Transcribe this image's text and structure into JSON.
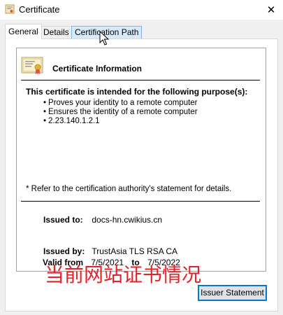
{
  "window": {
    "title": "Certificate",
    "close_glyph": "✕"
  },
  "tabs": [
    {
      "label": "General"
    },
    {
      "label": "Details"
    },
    {
      "label": "Certification Path"
    }
  ],
  "cert": {
    "info_title": "Certificate Information",
    "purpose_heading": "This certificate is intended for the following purpose(s):",
    "purposes": [
      "Proves your identity to a remote computer",
      "Ensures the identity of a remote computer",
      "2.23.140.1.2.1"
    ],
    "refer_note": "* Refer to the certification authority's statement for details.",
    "issued_to_label": "Issued to:",
    "issued_to_value": "docs-hn.cwikius.cn",
    "issued_by_label": "Issued by:",
    "issued_by_value": "TrustAsia TLS RSA CA",
    "valid_from_label": "Valid from",
    "valid_from_value": "7/5/2021",
    "valid_to_label": "to",
    "valid_to_value": "7/5/2022"
  },
  "watermark": "当前网站证书情况",
  "buttons": {
    "issuer_statement": "Issuer Statement"
  },
  "colors": {
    "accent": "#0078d7",
    "watermark": "#e8202a"
  }
}
